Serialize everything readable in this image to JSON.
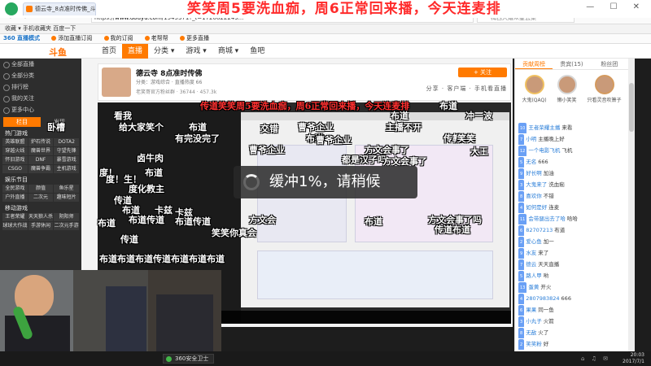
{
  "banner": {
    "text": "笑笑周5要洗血痂，周6正常回来播，今天连麦排"
  },
  "browser": {
    "tab_title": "德云寺_8点准时传佛_斗鱼",
    "url_prefix": "https://",
    "url_host": "www.douyu.com",
    "url_path": "/1545371?_t=1720822243...",
    "search_placeholder": "梅西大婚众星云集",
    "nav_arrows": "< >",
    "window_controls": "— ☐ ✕"
  },
  "favorites": {
    "label": "收藏 ▾   手机收藏夹   百度一下"
  },
  "toolbar360": {
    "logo": "360 直播模式",
    "items": [
      "添加直播订阅",
      "我的订阅",
      "老帮帮",
      "更多直播"
    ]
  },
  "sitenav": {
    "logo": "斗鱼",
    "items": [
      "首页",
      "直播",
      "分类 ▾",
      "游戏 ▾",
      "商城 ▾",
      "鱼吧"
    ]
  },
  "sidebar": {
    "items": [
      "全部直播",
      "全部分类",
      "排行榜",
      "我的关注",
      "更多中心"
    ],
    "tabs": [
      "栏目",
      "发现"
    ],
    "hot_title": "热门游戏",
    "hot_games": [
      "英雄联盟",
      "炉石传说",
      "DOTA2",
      "穿越火线",
      "魔兽世界",
      "守望先锋",
      "怀旧游戏",
      "DNF",
      "暴雪游戏",
      "CSGO",
      "魔兽争霸",
      "主机游戏"
    ],
    "ent_title": "娱乐节目",
    "ent_items": [
      "全民游戏",
      "颜值",
      "鱼乐星",
      "户外直播",
      "二次元",
      "趣味短片"
    ],
    "mobile_title": "移动游戏",
    "mobile_items": [
      "王者荣耀",
      "天天狼人杀",
      "阴阳师",
      "球球大作战",
      "手游休闲",
      "二次元手游"
    ]
  },
  "room": {
    "title": "德云寺 8点准时传佛",
    "meta": "分类：游戏综合  ·  直播热度 66",
    "meta2": "老笑哥官方粉丝群  ·  36744  ·  457.3k",
    "follow_label": "+ 关注",
    "follow_count": "4867323",
    "share_row": "分享  ·  客户端  ·  手机看直播"
  },
  "chat": {
    "tabs": [
      "贡献周榜",
      "贵宾(15)",
      "粉丝团"
    ],
    "ranks": [
      {
        "name": "大鬼(QAQ)"
      },
      {
        "name": "懒小笑笑"
      },
      {
        "name": "只看灵音吹箫子"
      }
    ],
    "messages": [
      {
        "badge": "10",
        "user": "王者荣耀主播",
        "text": "来看"
      },
      {
        "badge": "7",
        "user": "小明",
        "text": "主播晚上好"
      },
      {
        "badge": "12",
        "user": "一个电影飞机",
        "text": "飞机"
      },
      {
        "badge": "5",
        "user": "无名",
        "text": "666"
      },
      {
        "badge": "9",
        "user": "好长啊",
        "text": "加油"
      },
      {
        "badge": "3",
        "user": "大鬼来了",
        "text": "洗血痂"
      },
      {
        "badge": "8",
        "user": "喜欢你",
        "text": "不错"
      },
      {
        "badge": "4",
        "user": "如何是好",
        "text": "连麦"
      },
      {
        "badge": "11",
        "user": "会带腿出去了哈",
        "text": "哈哈"
      },
      {
        "badge": "6",
        "user": "82707213",
        "text": "布道"
      },
      {
        "badge": "2",
        "user": "爱心鱼",
        "text": "加一"
      },
      {
        "badge": "9",
        "user": "水友",
        "text": "来了"
      },
      {
        "badge": "7",
        "user": "德云",
        "text": "天天直播"
      },
      {
        "badge": "5",
        "user": "路人甲",
        "text": "哟"
      },
      {
        "badge": "13",
        "user": "蛋黄",
        "text": "开火"
      },
      {
        "badge": "4",
        "user": "2807983824",
        "text": "666"
      },
      {
        "badge": "6",
        "user": "果果",
        "text": "同一鱼"
      },
      {
        "badge": "3",
        "user": "小丸子",
        "text": "火箭"
      },
      {
        "badge": "8",
        "user": "无敌",
        "text": "火了"
      },
      {
        "badge": "2",
        "user": "笑笑粉",
        "text": "好"
      }
    ]
  },
  "buffer": {
    "text": "缓冲1%，请稍候"
  },
  "danmaku": [
    {
      "text": "布道",
      "color": "#ffffff"
    },
    {
      "text": "传道笑笑周5要洗血痂，周6正常回来播，今天连麦排",
      "color": "#ff3030"
    },
    {
      "text": "看我",
      "color": "#ffffff"
    },
    {
      "text": "布道",
      "color": "#ffffff"
    },
    {
      "text": "冲一波",
      "color": "#ffffff"
    },
    {
      "text": "卧槽",
      "color": "#ffffff"
    },
    {
      "text": "给大家笑个",
      "color": "#ffffff"
    },
    {
      "text": "曹爷企业",
      "color": "#ffffff"
    },
    {
      "text": "布道",
      "color": "#ffffff"
    },
    {
      "text": "主播不开",
      "color": "#ffffff"
    },
    {
      "text": "交错",
      "color": "#ffffff"
    },
    {
      "text": "布道",
      "color": "#ffffff"
    },
    {
      "text": "有完没完了",
      "color": "#ffffff"
    },
    {
      "text": "传教",
      "color": "#ffffff"
    },
    {
      "text": "曹爷企业",
      "color": "#ffffff"
    },
    {
      "text": "笑笑",
      "color": "#ffffff"
    },
    {
      "text": "方文会事了",
      "color": "#ffffff"
    },
    {
      "text": "曹爷企业",
      "color": "#ffffff"
    },
    {
      "text": "卤牛肉",
      "color": "#ffffff"
    },
    {
      "text": "都是汉子吗",
      "color": "#ffffff"
    },
    {
      "text": "方文会事了",
      "color": "#ffffff"
    },
    {
      "text": "大王",
      "color": "#ffffff"
    },
    {
      "text": "度！",
      "color": "#ffffff"
    },
    {
      "text": "布道",
      "color": "#ffffff"
    },
    {
      "text": "度！生！",
      "color": "#ffffff"
    },
    {
      "text": "度化教主",
      "color": "#ffffff"
    },
    {
      "text": "传道",
      "color": "#ffffff"
    },
    {
      "text": "布道",
      "color": "#ffffff"
    },
    {
      "text": "布道传道",
      "color": "#ffffff"
    },
    {
      "text": "卡兹",
      "color": "#ffffff"
    },
    {
      "text": "卡兹",
      "color": "#ffffff"
    },
    {
      "text": "方文会",
      "color": "#ffffff"
    },
    {
      "text": "布道传道",
      "color": "#ffffff"
    },
    {
      "text": "布道",
      "color": "#ffffff"
    },
    {
      "text": "传道",
      "color": "#ffffff"
    },
    {
      "text": "布道布道布道传道布道布道布道",
      "color": "#ffffff"
    },
    {
      "text": "布道",
      "color": "#ffffff"
    },
    {
      "text": "笑笑你真会",
      "color": "#ffffff"
    },
    {
      "text": "方文会事了吗",
      "color": "#ffffff"
    },
    {
      "text": "传道布道",
      "color": "#ffffff"
    }
  ],
  "statusbar": {
    "brand": "360安全卫士",
    "tray": "⌂ ♫ ✉",
    "time": "20:03",
    "date": "2017/7/1"
  }
}
